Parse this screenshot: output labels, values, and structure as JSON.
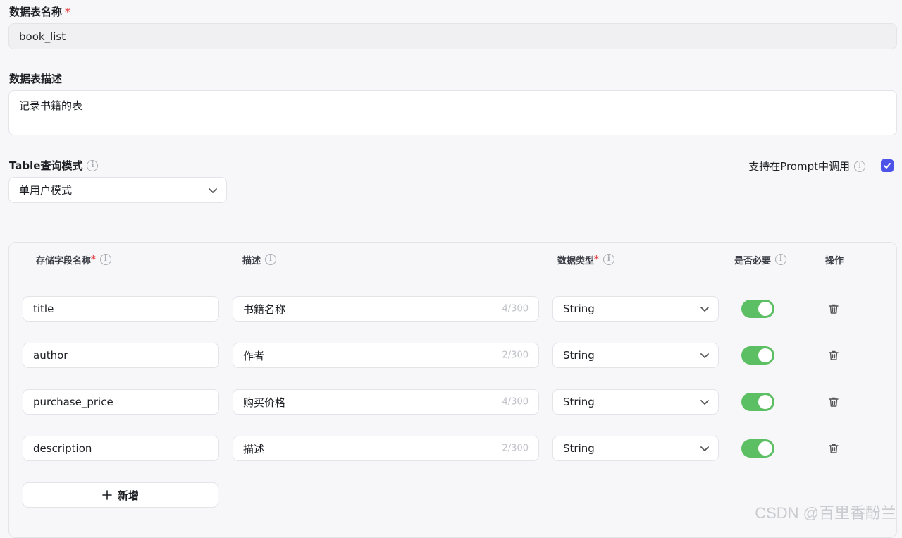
{
  "form": {
    "name_label": "数据表名称",
    "name_required": "*",
    "name_value": "book_list",
    "desc_label": "数据表描述",
    "desc_value": "记录书籍的表",
    "mode_label": "Table查询模式",
    "mode_value": "单用户模式",
    "prompt_label": "支持在Prompt中调用",
    "prompt_checked": true
  },
  "table": {
    "headers": {
      "field": "存储字段名称",
      "field_required": "*",
      "desc": "描述",
      "type": "数据类型",
      "type_required": "*",
      "required": "是否必要",
      "ops": "操作"
    },
    "rows": [
      {
        "name": "title",
        "desc": "书籍名称",
        "count": "4/300",
        "type": "String",
        "required": true
      },
      {
        "name": "author",
        "desc": "作者",
        "count": "2/300",
        "type": "String",
        "required": true
      },
      {
        "name": "purchase_price",
        "desc": "购买价格",
        "count": "4/300",
        "type": "String",
        "required": true
      },
      {
        "name": "description",
        "desc": "描述",
        "count": "2/300",
        "type": "String",
        "required": true
      }
    ],
    "add_label": "新增"
  },
  "watermark": "CSDN @百里香酚兰",
  "colors": {
    "accent": "#4d53e8",
    "toggle_on": "#5cbf63",
    "required": "#e5484d"
  }
}
